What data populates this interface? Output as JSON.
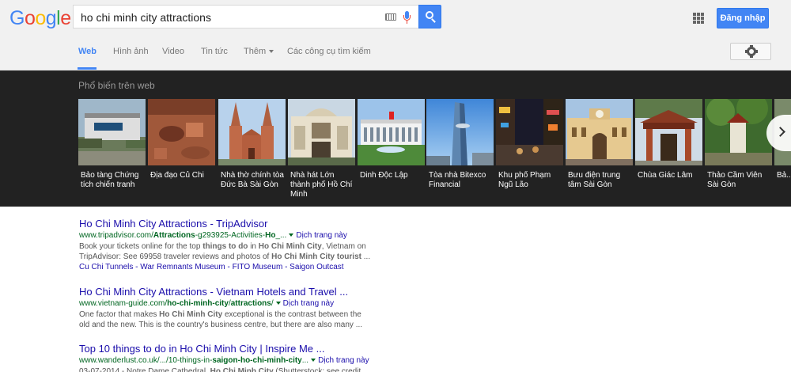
{
  "brand": {
    "logo_letters": [
      {
        "ch": "G",
        "color": "#4285f4"
      },
      {
        "ch": "o",
        "color": "#ea4335"
      },
      {
        "ch": "o",
        "color": "#fbbc05"
      },
      {
        "ch": "g",
        "color": "#4285f4"
      },
      {
        "ch": "l",
        "color": "#34a853"
      },
      {
        "ch": "e",
        "color": "#ea4335"
      }
    ],
    "accent": "#4285f4"
  },
  "search": {
    "query": "ho chi minh city attractions",
    "keyboard_icon": "keyboard-icon",
    "mic_icon": "mic-icon",
    "search_icon": "search-icon"
  },
  "header": {
    "apps_icon": "apps-grid-icon",
    "signin_label": "Đăng nhập"
  },
  "nav": {
    "tabs": [
      {
        "label": "Web",
        "active": true
      },
      {
        "label": "Hình ảnh"
      },
      {
        "label": "Video"
      },
      {
        "label": "Tin tức"
      },
      {
        "label": "Thêm"
      },
      {
        "label": "Các công cụ tìm kiếm"
      }
    ],
    "settings_icon": "gear-icon"
  },
  "carousel": {
    "title": "Phổ biến trên web",
    "cards": [
      {
        "label": "Bảo tàng Chứng tích chiến tranh"
      },
      {
        "label": "Địa đạo Củ Chi"
      },
      {
        "label": "Nhà thờ chính tòa Đức Bà Sài Gòn"
      },
      {
        "label": "Nhà hát Lớn thành phố Hồ Chí Minh"
      },
      {
        "label": "Dinh Độc Lập"
      },
      {
        "label": "Tòa nhà Bitexco Financial"
      },
      {
        "label": "Khu phố Phạm Ngũ Lão"
      },
      {
        "label": "Bưu điện trung tâm Sài Gòn"
      },
      {
        "label": "Chùa Giác Lâm"
      },
      {
        "label": "Thảo Cầm Viên Sài Gòn"
      },
      {
        "label": "Bả..."
      }
    ],
    "next_icon": "chevron-right-icon"
  },
  "results": [
    {
      "title": "Ho Chi Minh City Attractions - TripAdvisor",
      "url_pre": "www.tripadvisor.com/",
      "url_bold": "Attractions",
      "url_post": "-g293925-Activities-",
      "url_bold2": "Ho",
      "url_tail": "_...",
      "translate": "Dịch trang này",
      "snippet_parts": [
        {
          "t": "Book your tickets online for the top "
        },
        {
          "t": "things to do",
          "b": true
        },
        {
          "t": " in "
        },
        {
          "t": "Ho Chi Minh City",
          "b": true
        },
        {
          "t": ", Vietnam on TripAdvisor: See 69958 traveler reviews and photos of "
        },
        {
          "t": "Ho Chi Minh City tourist",
          "b": true
        },
        {
          "t": " ..."
        }
      ],
      "sitelinks": "Cu Chi Tunnels - War Remnants Museum - FITO Museum - Saigon Outcast"
    },
    {
      "title": "Ho Chi Minh City Attractions - Vietnam Hotels and Travel ...",
      "url_pre": "www.vietnam-guide.com/",
      "url_bold": "ho-chi-minh-city",
      "url_post": "/",
      "url_bold2": "attractions",
      "url_tail": "/",
      "translate": "Dịch trang này",
      "snippet_parts": [
        {
          "t": "One factor that makes "
        },
        {
          "t": "Ho Chi Minh City",
          "b": true
        },
        {
          "t": " exceptional is the contrast between the old and the new. This is the country's business centre, but there are also many ..."
        }
      ]
    },
    {
      "title": "Top 10 things to do in Ho Chi Minh City | Inspire Me ...",
      "url_pre": "www.wanderlust.co.uk/.../10-things-in-",
      "url_bold": "saigon-ho-chi-minh-city",
      "url_post": "...",
      "url_bold2": "",
      "url_tail": "",
      "translate": "Dịch trang này",
      "snippet_parts": [
        {
          "t": "03-07-2014 - Notre Dame Cathedral, "
        },
        {
          "t": "Ho Chi Minh City",
          "b": true
        },
        {
          "t": " (Shutterstock: see credit ... hoi"
        }
      ]
    }
  ]
}
